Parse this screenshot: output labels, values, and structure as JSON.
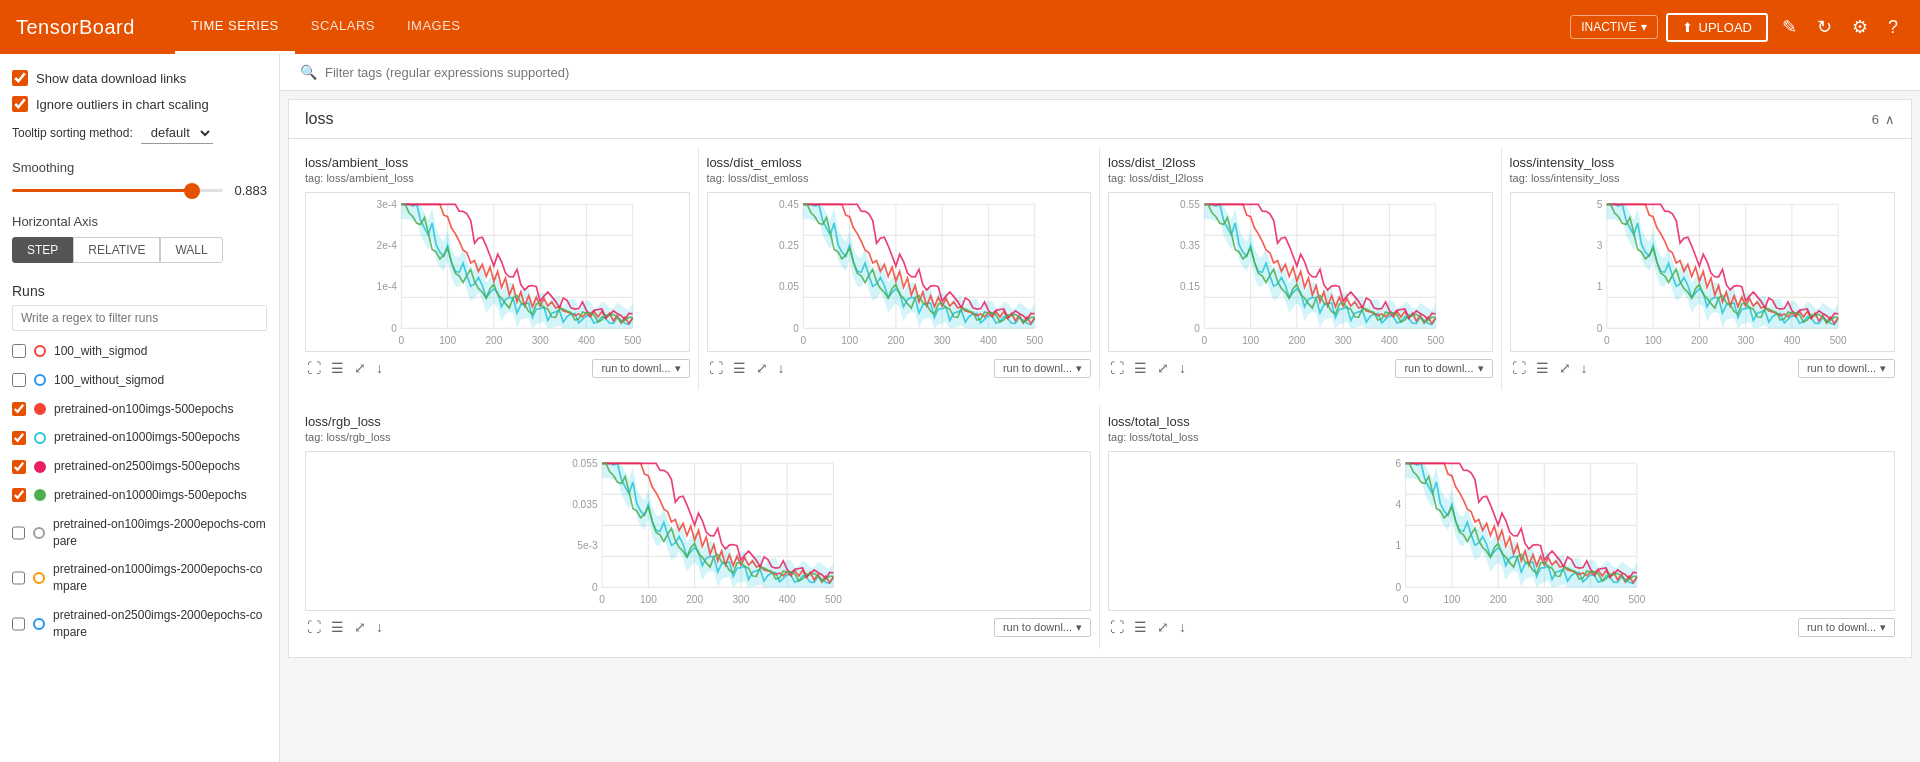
{
  "topnav": {
    "brand": "TensorBoard",
    "links": [
      {
        "label": "TIME SERIES",
        "active": true
      },
      {
        "label": "SCALARS",
        "active": false
      },
      {
        "label": "IMAGES",
        "active": false
      }
    ],
    "inactive_label": "INACTIVE",
    "upload_label": "UPLOAD"
  },
  "sidebar": {
    "show_download_links": {
      "label": "Show data download links",
      "checked": true
    },
    "ignore_outliers": {
      "label": "Ignore outliers in chart scaling",
      "checked": true
    },
    "tooltip_label": "Tooltip sorting method:",
    "tooltip_value": "default",
    "smoothing_label": "Smoothing",
    "smoothing_value": "0.883",
    "haxis_label": "Horizontal Axis",
    "haxis_options": [
      "STEP",
      "RELATIVE",
      "WALL"
    ],
    "haxis_active": "STEP",
    "runs_label": "Runs",
    "runs_filter_placeholder": "Write a regex to filter runs",
    "runs": [
      {
        "label": "100_with_sigmod",
        "checked": false,
        "color": "transparent",
        "border": "#f44336"
      },
      {
        "label": "100_without_sigmod",
        "checked": false,
        "color": "transparent",
        "border": "#2196f3"
      },
      {
        "label": "pretrained-on100imgs-500epochs",
        "checked": true,
        "color": "#f44336",
        "border": "#f44336"
      },
      {
        "label": "pretrained-on1000imgs-500epochs",
        "checked": true,
        "color": "transparent",
        "border": "#26c6da"
      },
      {
        "label": "pretrained-on2500imgs-500epochs",
        "checked": true,
        "color": "#e91e63",
        "border": "#e91e63"
      },
      {
        "label": "pretrained-on10000imgs-500epochs",
        "checked": true,
        "color": "#4caf50",
        "border": "#4caf50"
      },
      {
        "label": "pretrained-on100imgs-2000epochs-compare",
        "checked": false,
        "color": "transparent",
        "border": "#9e9e9e"
      },
      {
        "label": "pretrained-on1000imgs-2000epochs-compare",
        "checked": false,
        "color": "transparent",
        "border": "#ff9800"
      },
      {
        "label": "pretrained-on2500imgs-2000epochs-compare",
        "checked": false,
        "color": "transparent",
        "border": "#2196f3"
      }
    ]
  },
  "filter": {
    "placeholder": "Filter tags (regular expressions supported)"
  },
  "loss_section": {
    "title": "loss",
    "count": "6",
    "charts_row1": [
      {
        "title": "loss/ambient_loss",
        "tag": "tag: loss/ambient_loss",
        "ymax": "3e-4",
        "ymid": "2e-4",
        "ylow": "1e-4",
        "ymin": "0",
        "xmax": "500"
      },
      {
        "title": "loss/dist_emloss",
        "tag": "tag: loss/dist_emloss",
        "ymax": "0.45",
        "ymid": "0.25",
        "ylow": "0.05",
        "xmax": "500"
      },
      {
        "title": "loss/dist_l2loss",
        "tag": "tag: loss/dist_l2loss",
        "ymax": "0.55",
        "ymid": "0.35",
        "ylow": "0.15",
        "xmax": "500"
      },
      {
        "title": "loss/intensity_loss",
        "tag": "tag: loss/intensity_loss",
        "ymax": "5",
        "ymid": "3",
        "ylow": "1",
        "xmax": "500"
      }
    ],
    "charts_row2": [
      {
        "title": "loss/rgb_loss",
        "tag": "tag: loss/rgb_loss",
        "ymax": "0.055",
        "ymid": "0.035",
        "ylow": "5e-3",
        "xmax": "500"
      },
      {
        "title": "loss/total_loss",
        "tag": "tag: loss/total_loss",
        "ymax": "6",
        "ymid": "4",
        "ylow": "1",
        "xmax": "500"
      }
    ]
  },
  "toolbar": {
    "expand_icon": "⛶",
    "list_icon": "☰",
    "fullscreen_icon": "⤢",
    "download_icon": "↓",
    "run_to_download": "run to downl..."
  }
}
